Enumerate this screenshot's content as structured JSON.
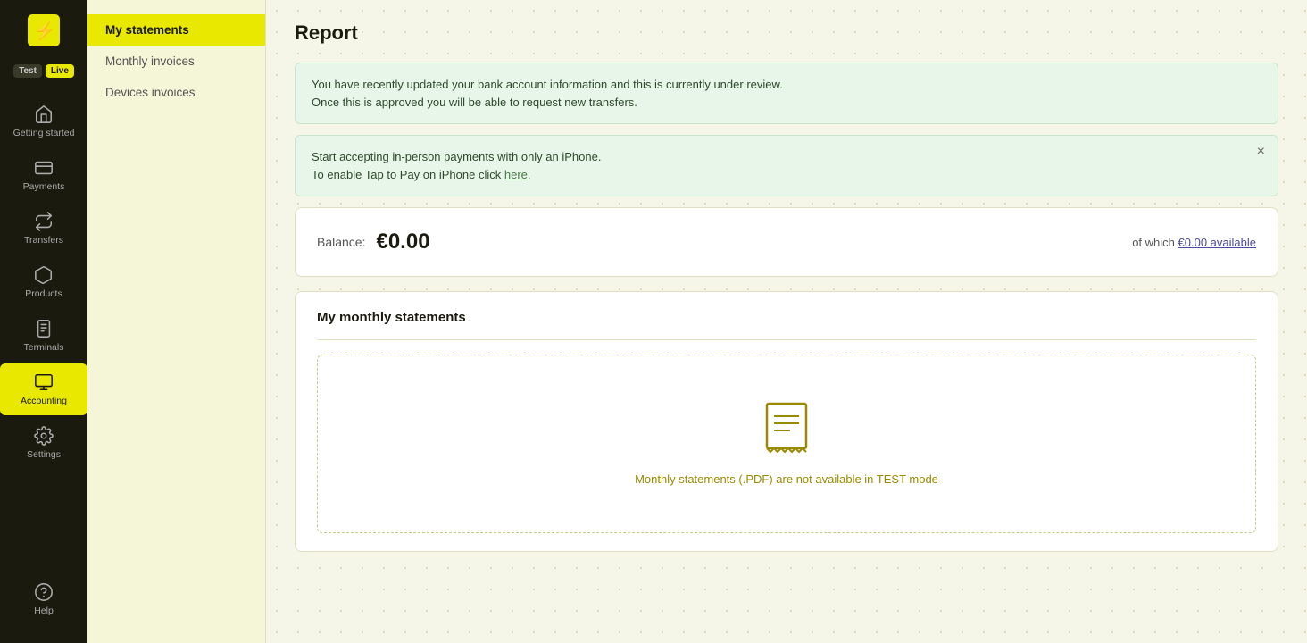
{
  "app": {
    "logo_text": "⚡",
    "env_test": "Test",
    "env_live": "Live"
  },
  "sidebar": {
    "items": [
      {
        "id": "getting-started",
        "label": "Getting started",
        "icon": "home"
      },
      {
        "id": "payments",
        "label": "Payments",
        "icon": "payments"
      },
      {
        "id": "transfers",
        "label": "Transfers",
        "icon": "transfers"
      },
      {
        "id": "products",
        "label": "Products",
        "icon": "products"
      },
      {
        "id": "terminals",
        "label": "Terminals",
        "icon": "terminals"
      },
      {
        "id": "accounting",
        "label": "Accounting",
        "icon": "accounting",
        "active": true
      },
      {
        "id": "settings",
        "label": "Settings",
        "icon": "settings"
      }
    ],
    "bottom": [
      {
        "id": "help",
        "label": "Help",
        "icon": "help"
      }
    ]
  },
  "secondary_nav": {
    "items": [
      {
        "id": "my-statements",
        "label": "My statements",
        "active": true
      },
      {
        "id": "monthly-invoices",
        "label": "Monthly invoices"
      },
      {
        "id": "devices-invoices",
        "label": "Devices invoices"
      }
    ]
  },
  "page": {
    "title": "Report"
  },
  "alerts": [
    {
      "id": "bank-review",
      "text1": "You have recently updated your bank account information and this is currently under review.",
      "text2": "Once this is approved you will be able to request new transfers.",
      "closable": false
    },
    {
      "id": "tap-to-pay",
      "text1": "Start accepting in-person payments with only an iPhone.",
      "text2_prefix": "To enable Tap to Pay on iPhone click ",
      "text2_link": "here",
      "text2_suffix": ".",
      "closable": true
    }
  ],
  "balance_card": {
    "label": "Balance:",
    "amount": "€0.00",
    "of_which": "of which",
    "available_link": "€0.00 available"
  },
  "statements_card": {
    "title": "My monthly statements",
    "empty_text": "Monthly statements (.PDF) are not available in TEST mode"
  }
}
